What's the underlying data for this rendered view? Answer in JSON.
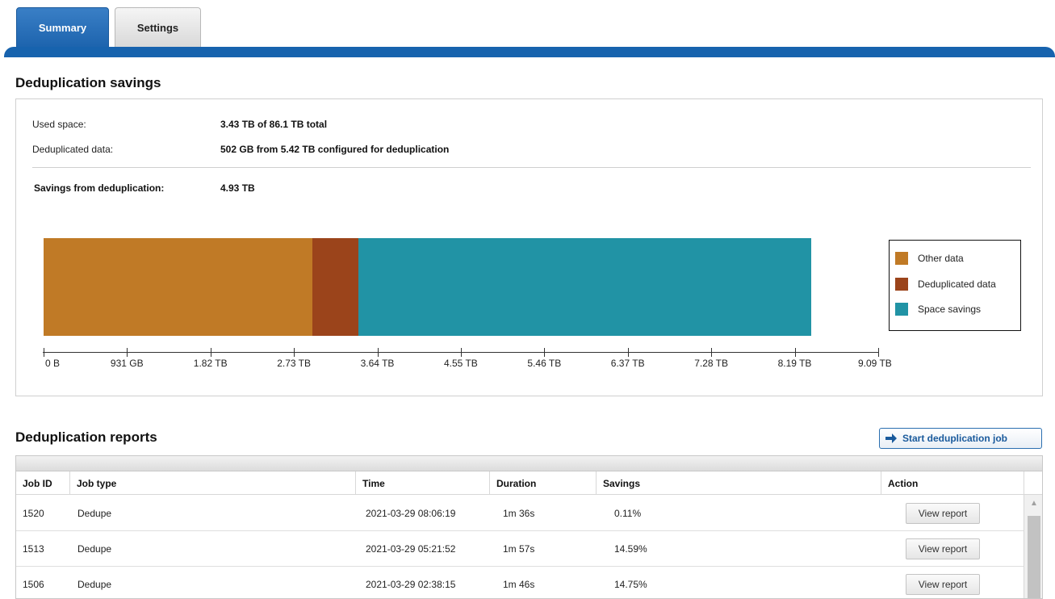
{
  "tabs": [
    {
      "label": "Summary",
      "active": true
    },
    {
      "label": "Settings",
      "active": false
    }
  ],
  "savings_section": {
    "title": "Deduplication savings",
    "used_space_label": "Used space:",
    "used_space_value": "3.43 TB of 86.1 TB total",
    "dedup_data_label": "Deduplicated data:",
    "dedup_data_value": "502 GB from 5.42 TB configured for deduplication",
    "savings_label": "Savings from deduplication:",
    "savings_value": "4.93 TB"
  },
  "chart_data": {
    "type": "bar",
    "orientation": "horizontal-stacked",
    "segments": [
      {
        "name": "Other data",
        "value_tb": 2.93,
        "color": "#c07a26"
      },
      {
        "name": "Deduplicated data",
        "value_tb": 0.5,
        "color": "#9b441b"
      },
      {
        "name": "Space savings",
        "value_tb": 4.93,
        "color": "#2193a5"
      }
    ],
    "xlim_tb": [
      0,
      9.09
    ],
    "tick_labels": [
      "0 B",
      "931 GB",
      "1.82 TB",
      "2.73 TB",
      "3.64 TB",
      "4.55 TB",
      "5.46 TB",
      "6.37 TB",
      "7.28 TB",
      "8.19 TB",
      "9.09 TB"
    ],
    "legend": [
      "Other data",
      "Deduplicated data",
      "Space savings"
    ],
    "legend_position": "right"
  },
  "reports_section": {
    "title": "Deduplication reports",
    "start_button_label": "Start deduplication job",
    "columns": [
      "Job ID",
      "Job type",
      "Time",
      "Duration",
      "Savings",
      "Action"
    ],
    "rows": [
      {
        "job_id": "1520",
        "job_type": "Dedupe",
        "time": "2021-03-29 08:06:19",
        "duration": "1m 36s",
        "savings": "0.11%",
        "action": "View report"
      },
      {
        "job_id": "1513",
        "job_type": "Dedupe",
        "time": "2021-03-29 05:21:52",
        "duration": "1m 57s",
        "savings": "14.59%",
        "action": "View report"
      },
      {
        "job_id": "1506",
        "job_type": "Dedupe",
        "time": "2021-03-29 02:38:15",
        "duration": "1m 46s",
        "savings": "14.75%",
        "action": "View report"
      }
    ]
  }
}
